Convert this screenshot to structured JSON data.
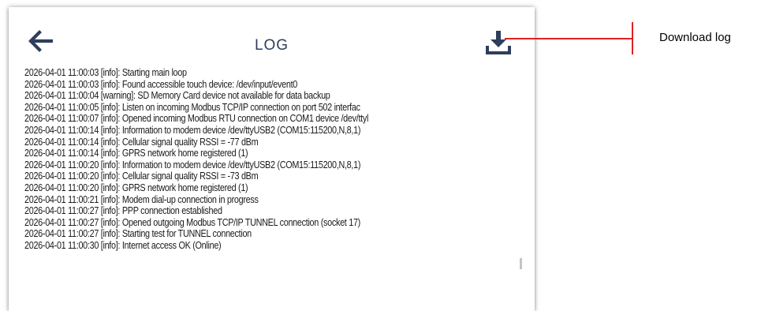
{
  "header": {
    "title": "LOG",
    "back_icon": "arrow-left-icon",
    "download_icon": "download-icon"
  },
  "colors": {
    "accent": "#2f3e5c",
    "callout": "#e02020"
  },
  "log": {
    "lines": [
      "2026-04-01 11:00:03 [info]: Starting main loop",
      "2026-04-01 11:00:03 [info]: Found accessible touch device: /dev/input/event0",
      "2026-04-01 11:00:04 [warning]: SD Memory Card device not available for data backup",
      "2026-04-01 11:00:05 [info]: Listen on incoming Modbus TCP/IP connection on port 502 interfac",
      "2026-04-01 11:00:07 [info]: Opened incoming Modbus RTU connection on COM1 device /dev/ttyl",
      "2026-04-01 11:00:14 [info]: Information to modem device /dev/ttyUSB2 (COM15:115200,N,8,1)",
      "2026-04-01 11:00:14 [info]: Cellular signal quality RSSI = -77 dBm",
      "2026-04-01 11:00:14 [info]: GPRS network home registered (1)",
      "2026-04-01 11:00:20 [info]: Information to modem device /dev/ttyUSB2 (COM15:115200,N,8,1)",
      "2026-04-01 11:00:20 [info]: Cellular signal quality RSSI = -73 dBm",
      "2026-04-01 11:00:20 [info]: GPRS network home registered (1)",
      "2026-04-01 11:00:21 [info]: Modem dial-up connection in progress",
      "2026-04-01 11:00:27 [info]: PPP connection established",
      "2026-04-01 11:00:27 [info]: Opened outgoing Modbus TCP/IP TUNNEL connection (socket 17)",
      "2026-04-01 11:00:27 [info]: Starting test for TUNNEL connection",
      "2026-04-01 11:00:30 [info]: Internet access OK (Online)"
    ]
  },
  "callout": {
    "label": "Download log"
  }
}
